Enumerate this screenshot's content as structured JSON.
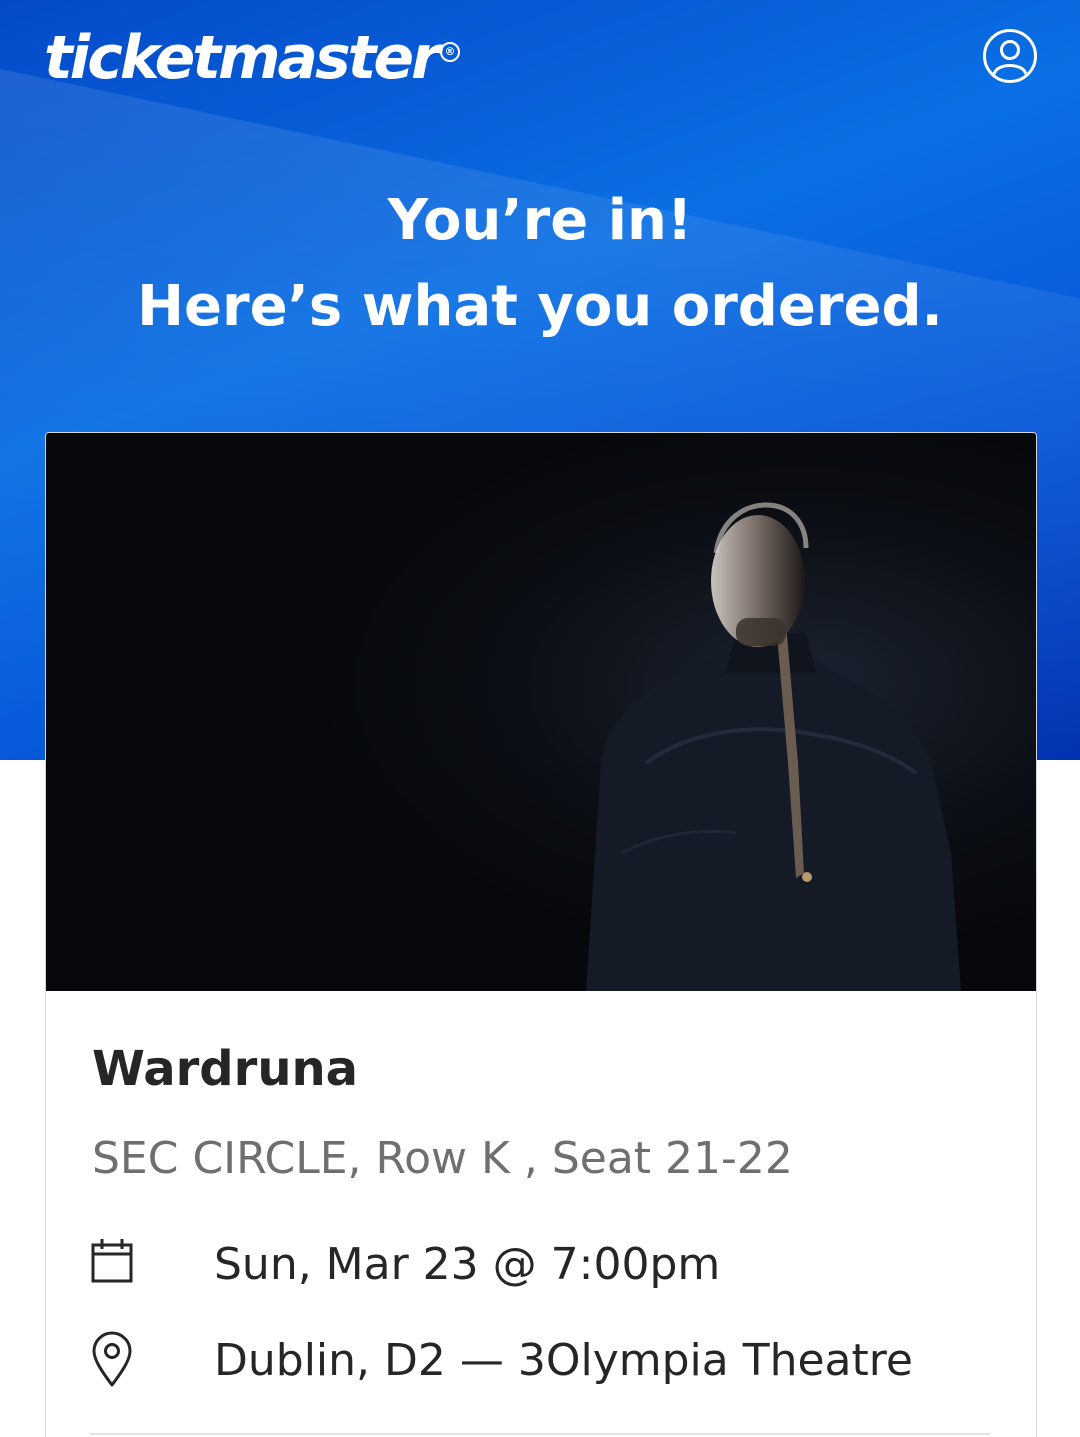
{
  "header": {
    "logo_text": "ticketmaster",
    "logo_mark": "®",
    "account_icon": "user-account-icon",
    "colors": {
      "brand_blue": "#0a6fe4",
      "brand_dark_blue": "#0233b0"
    }
  },
  "hero": {
    "line1": "You’re in!",
    "line2": "Here’s what you ordered."
  },
  "order": {
    "image_icon": "artist-photo",
    "title": "Wardruna",
    "seat": "SEC CIRCLE, Row K , Seat 21-22",
    "date_icon": "calendar-icon",
    "date": "Sun, Mar 23 @ 7:00pm",
    "venue_icon": "location-pin-icon",
    "venue": "Dublin, D2 — 3Olympia Theatre"
  }
}
